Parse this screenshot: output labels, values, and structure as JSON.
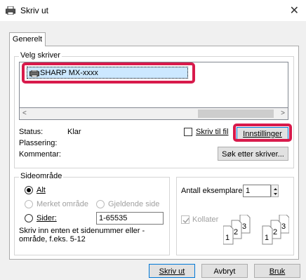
{
  "window": {
    "title": "Skriv ut"
  },
  "tabs": [
    {
      "label": "Generelt"
    }
  ],
  "select_printer": {
    "group_title": "Velg skriver",
    "printer_name": "SHARP MX-xxxx",
    "status_label": "Status:",
    "status_value": "Klar",
    "location_label": "Plassering:",
    "comment_label": "Kommentar:",
    "print_to_file_label": "Skriv til fil",
    "preferences_button": "Innstillinger",
    "find_printer_button": "Søk etter skriver..."
  },
  "page_range": {
    "group_title": "Sideområde",
    "all_label": "Alt",
    "selection_label": "Merket område",
    "current_page_label": "Gjeldende side",
    "pages_label": "Sider:",
    "pages_value": "1-65535",
    "hint": "Skriv inn enten et sidenummer eller -område, f.eks. 5-12",
    "selected": "all"
  },
  "copies": {
    "count_label": "Antall eksemplarer:",
    "count_value": "1",
    "collate_label": "Kollater",
    "collate_checked": true,
    "collate_enabled": false,
    "collate_icon_digits": [
      "1",
      "2",
      "3",
      "1",
      "2",
      "3"
    ]
  },
  "footer": {
    "print_button": "Skriv ut",
    "cancel_button": "Avbryt",
    "apply_button": "Bruk"
  },
  "colors": {
    "highlight": "#d81a4b",
    "selection": "#cce8ff"
  }
}
